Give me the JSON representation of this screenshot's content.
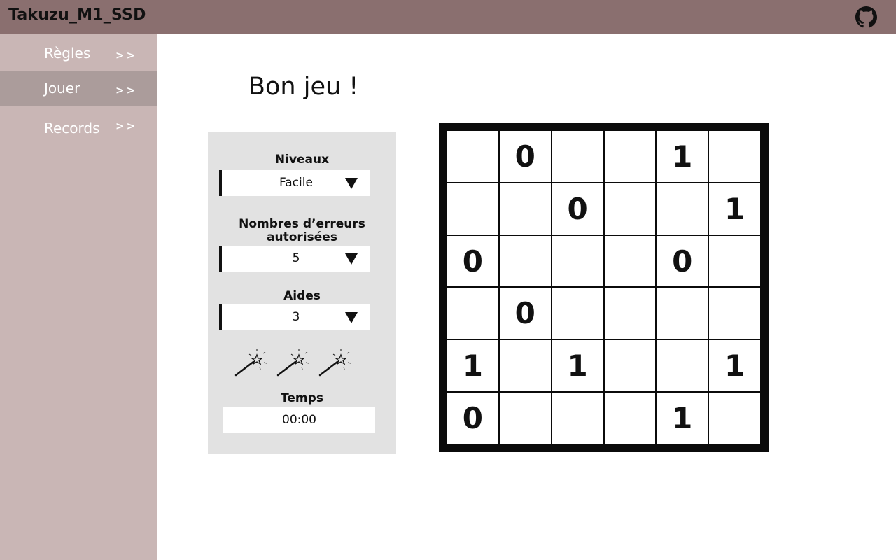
{
  "app": {
    "title": "Takuzu_M1_SSD",
    "github_icon": "github-icon"
  },
  "sidebar": {
    "items": [
      {
        "label": "Règles",
        "arrow": ">>",
        "active": false
      },
      {
        "label": "Jouer",
        "arrow": ">>",
        "active": true
      },
      {
        "label": "Records",
        "arrow": ">>",
        "active": false
      }
    ]
  },
  "main": {
    "heading": "Bon jeu !"
  },
  "settings": {
    "level_label": "Niveaux",
    "level_value": "Facile",
    "errors_label_line1": "Nombres d’erreurs",
    "errors_label_line2": "autorisées",
    "errors_value": "5",
    "hints_label": "Aides",
    "hints_value": "3",
    "hint_icons": [
      "magic-wand-icon",
      "magic-wand-icon",
      "magic-wand-icon"
    ],
    "time_label": "Temps",
    "time_value": "00:00"
  },
  "grid": {
    "size": 6,
    "cells": [
      [
        "",
        "0",
        "",
        "",
        "1",
        ""
      ],
      [
        "",
        "",
        "0",
        "",
        "",
        "1"
      ],
      [
        "0",
        "",
        "",
        "",
        "0",
        ""
      ],
      [
        "",
        "0",
        "",
        "",
        "",
        ""
      ],
      [
        "1",
        "",
        "1",
        "",
        "",
        "1"
      ],
      [
        "0",
        "",
        "",
        "",
        "1",
        ""
      ]
    ]
  },
  "colors": {
    "topbar": "#8a6f6f",
    "sidebar": "#c9b6b5",
    "sidebar_active": "#ab9c9b",
    "panel": "#e2e2e2"
  }
}
